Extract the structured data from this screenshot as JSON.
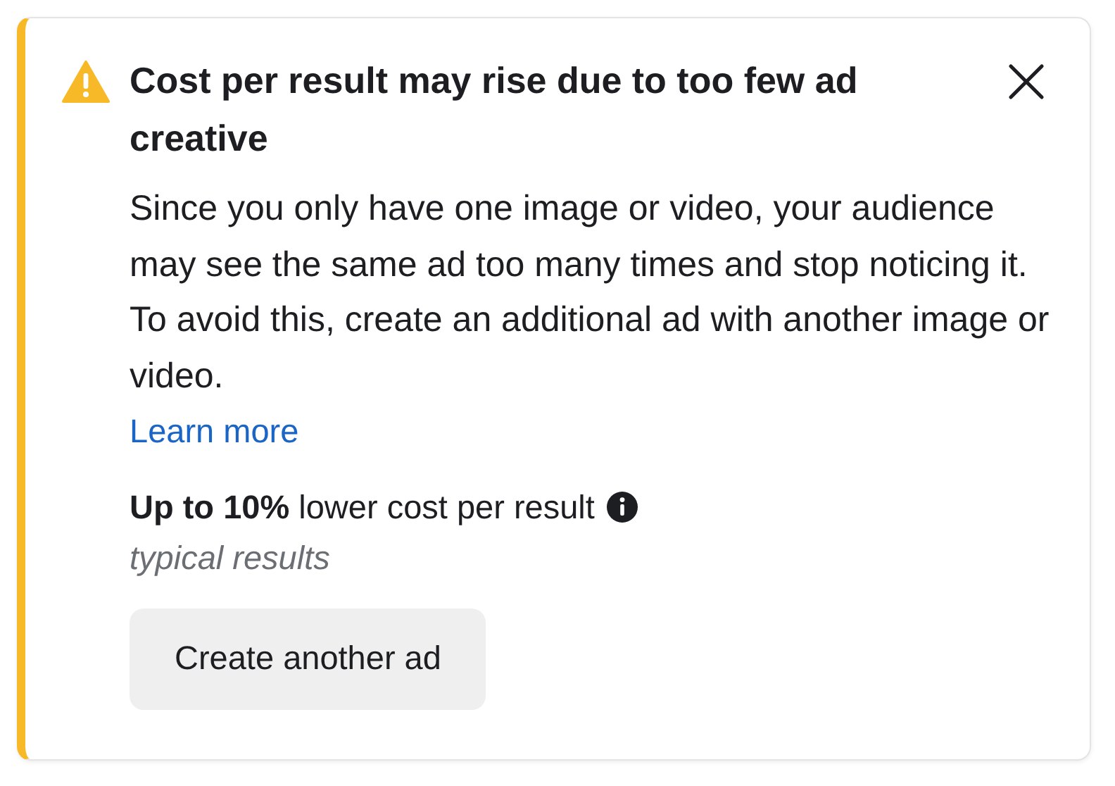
{
  "alert": {
    "title": "Cost per result may rise due to too few ad creative",
    "message": "Since you only have one image or video, your audience may see the same ad too many times and stop noticing it. To avoid this, create an additional ad with another image or video.",
    "link": "Learn more",
    "benefit": "**Up to 10%** lower cost per result",
    "note": "typical results",
    "button": "Create another ad"
  }
}
